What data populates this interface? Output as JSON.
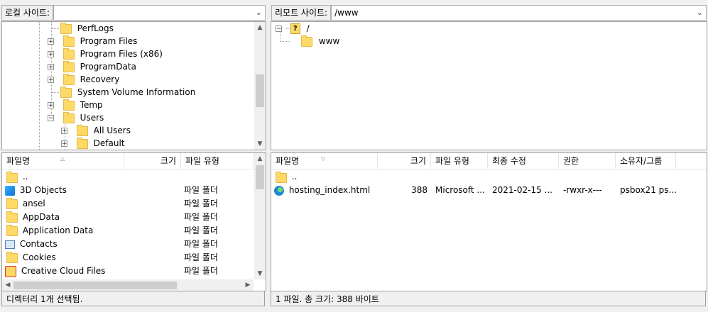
{
  "local": {
    "address_label": "로컬 사이트:",
    "address_value": "",
    "tree": [
      {
        "label": "PerfLogs",
        "expander": ""
      },
      {
        "label": "Program Files",
        "expander": "+"
      },
      {
        "label": "Program Files (x86)",
        "expander": "+"
      },
      {
        "label": "ProgramData",
        "expander": "+"
      },
      {
        "label": "Recovery",
        "expander": "+"
      },
      {
        "label": "System Volume Information",
        "expander": ""
      },
      {
        "label": "Temp",
        "expander": "+"
      },
      {
        "label": "Users",
        "expander": "−"
      },
      {
        "label": "All Users",
        "expander": "+"
      },
      {
        "label": "Default",
        "expander": "+"
      }
    ],
    "columns": {
      "name": "파일명",
      "size": "크기",
      "type": "파일 유형"
    },
    "files": [
      {
        "name": "..",
        "type": "",
        "icon": "folder-icon"
      },
      {
        "name": "3D Objects",
        "type": "파일 폴더",
        "icon": "3d-objects-icon"
      },
      {
        "name": "ansel",
        "type": "파일 폴더",
        "icon": "folder-icon"
      },
      {
        "name": "AppData",
        "type": "파일 폴더",
        "icon": "folder-icon"
      },
      {
        "name": "Application Data",
        "type": "파일 폴더",
        "icon": "folder-icon"
      },
      {
        "name": "Contacts",
        "type": "파일 폴더",
        "icon": "contacts-icon"
      },
      {
        "name": "Cookies",
        "type": "파일 폴더",
        "icon": "folder-icon"
      },
      {
        "name": "Creative Cloud Files",
        "type": "파일 폴더",
        "icon": "creative-cloud-icon"
      }
    ],
    "status": "디렉터리 1개 선택됨."
  },
  "remote": {
    "address_label": "리모트 사이트:",
    "address_value": "/www",
    "tree": [
      {
        "label": "/",
        "expander": "−",
        "icon": "unknown-folder-icon"
      },
      {
        "label": "www",
        "expander": "",
        "icon": "folder-icon"
      }
    ],
    "columns": {
      "name": "파일명",
      "size": "크기",
      "type": "파일 유형",
      "modified": "최종 수정",
      "perms": "권한",
      "owner": "소유자/그룹"
    },
    "files": [
      {
        "name": "..",
        "size": "",
        "type": "",
        "modified": "",
        "perms": "",
        "owner": "",
        "icon": "folder-icon"
      },
      {
        "name": "hosting_index.html",
        "size": "388",
        "type": "Microsoft ...",
        "modified": "2021-02-15 ...",
        "perms": "-rwxr-x---",
        "owner": "psbox21 ps...",
        "icon": "edge-html-icon"
      }
    ],
    "status": "1 파일. 총 크기: 388 바이트"
  }
}
